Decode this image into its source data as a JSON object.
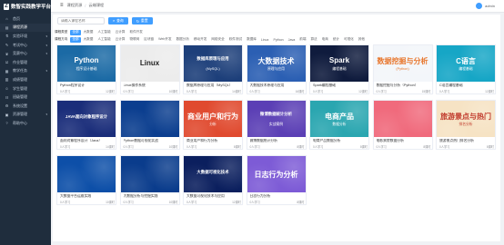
{
  "app": {
    "logo_mark": "Z",
    "title": "数智实践教学平台"
  },
  "header": {
    "menu_icon": "menu-icon",
    "crumb_home": "课程资源",
    "crumb_current": "云端课程",
    "user_name": "admin"
  },
  "sidebar": {
    "items": [
      {
        "label": "首页",
        "icon": "home-icon",
        "active": false,
        "caret": ""
      },
      {
        "label": "课程资源",
        "icon": "book-icon",
        "active": true,
        "caret": ""
      },
      {
        "label": "实验环境",
        "icon": "flask-icon",
        "active": false,
        "caret": "▾"
      },
      {
        "label": "考试中心",
        "icon": "exam-icon",
        "active": false,
        "caret": "▾"
      },
      {
        "label": "竞赛中心",
        "icon": "trophy-icon",
        "active": false,
        "caret": "▾"
      },
      {
        "label": "作业管理",
        "icon": "task-icon",
        "active": false,
        "caret": ""
      },
      {
        "label": "教学任务",
        "icon": "calendar-icon",
        "active": false,
        "caret": "▾"
      },
      {
        "label": "成绩管理",
        "icon": "chart-icon",
        "active": false,
        "caret": ""
      },
      {
        "label": "学生管理",
        "icon": "user-icon",
        "active": false,
        "caret": ""
      },
      {
        "label": "班级管理",
        "icon": "group-icon",
        "active": false,
        "caret": ""
      },
      {
        "label": "系统设置",
        "icon": "gear-icon",
        "active": false,
        "caret": ""
      },
      {
        "label": "资源管理",
        "icon": "folder-icon",
        "active": false,
        "caret": "▾"
      },
      {
        "label": "帮助中心",
        "icon": "help-icon",
        "active": false,
        "caret": ""
      }
    ]
  },
  "search": {
    "placeholder": "请输入课程名称",
    "search_label": "查询",
    "reset_label": "重置"
  },
  "filters": {
    "type_title": "课程类型",
    "type_items": [
      "全部",
      "大数据",
      "人工智能",
      "云计算",
      "软件开发"
    ],
    "dir_title": "课程方向",
    "dir_items": [
      "全部",
      "大数据",
      "人工智能",
      "云计算",
      "物联网",
      "区块链",
      "Web开发",
      "数据分析",
      "移动开发",
      "网络安全",
      "软件测试",
      "数据库",
      "Linux",
      "Python",
      "Java",
      "前端",
      "算法",
      "电商",
      "统计",
      "可视化",
      "其他"
    ]
  },
  "courses": [
    {
      "title": "Python程序设计",
      "thumb": "Python",
      "sub": "程序设计基础",
      "students": "0人学习",
      "chapters": "12课时",
      "bg": "#1b6aa5",
      "fg": "#ffffff"
    },
    {
      "title": "Linux操作系统",
      "thumb": "Linux",
      "sub": "",
      "students": "0人学习",
      "chapters": "10课时",
      "bg": "#ececec",
      "fg": "#222222"
    },
    {
      "title": "数据库原理与应用（MySQL）",
      "thumb": "数据库原理与应用",
      "sub": "(MySQL)",
      "students": "0人学习",
      "chapters": "14课时",
      "bg": "#1d3f7a",
      "fg": "#ffffff"
    },
    {
      "title": "大数据技术原理与应用",
      "thumb": "大数据技术",
      "sub": "原理与应用",
      "students": "0人学习",
      "chapters": "16课时",
      "bg": "#2b5fb3",
      "fg": "#ffffff"
    },
    {
      "title": "Spark编程基础",
      "thumb": "Spark",
      "sub": "编程基础",
      "students": "0人学习",
      "chapters": "12课时",
      "bg": "#0f1b3d",
      "fg": "#ffffff"
    },
    {
      "title": "数据挖掘与分析（Python）",
      "thumb": "数据挖掘与分析",
      "sub": "(Python)",
      "students": "0人学习",
      "chapters": "15课时",
      "bg": "#f3f6fa",
      "fg": "#e8772e"
    },
    {
      "title": "C语言编程基础",
      "thumb": "C语言",
      "sub": "编程基础",
      "students": "0人学习",
      "chapters": "12课时",
      "bg": "#16a6c6",
      "fg": "#ffffff"
    },
    {
      "title": "面向对象程序设计（Java）",
      "thumb": "JAVA面向对象程序设计",
      "sub": "",
      "students": "0人学习",
      "chapters": "14课时",
      "bg": "#1a2d7a",
      "fg": "#ffffff"
    },
    {
      "title": "Python数据可视化实战",
      "thumb": "",
      "sub": "",
      "students": "0人学习",
      "chapters": "10课时",
      "bg": "#0b3e8f",
      "fg": "#ffffff"
    },
    {
      "title": "商业用户和行为分析",
      "thumb": "商业用户和行为",
      "sub": "分析",
      "students": "0人学习",
      "chapters": "8课时",
      "bg": "#e04a2f",
      "fg": "#ffffff"
    },
    {
      "title": "微博数据统计分析",
      "thumb": "微博数据统计分析",
      "sub": "实战案例",
      "students": "0人学习",
      "chapters": "8课时",
      "bg": "#5b3fb5",
      "fg": "#ffffff"
    },
    {
      "title": "电商产品数据分析",
      "thumb": "电商产品",
      "sub": "数据分析",
      "students": "0人学习",
      "chapters": "8课时",
      "bg": "#2aa6b0",
      "fg": "#ffffff"
    },
    {
      "title": "电影票房数据分析",
      "thumb": "",
      "sub": "",
      "students": "0人学习",
      "chapters": "8课时",
      "bg": "#f06a7c",
      "fg": "#ffffff"
    },
    {
      "title": "旅游景点热门排名分析",
      "thumb": "旅游景点与热门",
      "sub": "排名分析",
      "students": "0人学习",
      "chapters": "8课时",
      "bg": "#f6e3c4",
      "fg": "#c0392b"
    },
    {
      "title": "大数据平台运维实践",
      "thumb": "",
      "sub": "",
      "students": "0人学习",
      "chapters": "10课时",
      "bg": "#0d4fa8",
      "fg": "#ffffff"
    },
    {
      "title": "大数据分析与挖掘实践",
      "thumb": "",
      "sub": "",
      "students": "0人学习",
      "chapters": "10课时",
      "bg": "#0a3c8c",
      "fg": "#ffffff"
    },
    {
      "title": "大数据可视化技术与应用",
      "thumb": "大数据可视化技术",
      "sub": "",
      "students": "0人学习",
      "chapters": "12课时",
      "bg": "#0b1f5e",
      "fg": "#ffffff"
    },
    {
      "title": "日志行为分析",
      "thumb": "日志行为分析",
      "sub": "",
      "students": "0人学习",
      "chapters": "8课时",
      "bg": "#7d5bd6",
      "fg": "#ffffff"
    }
  ]
}
